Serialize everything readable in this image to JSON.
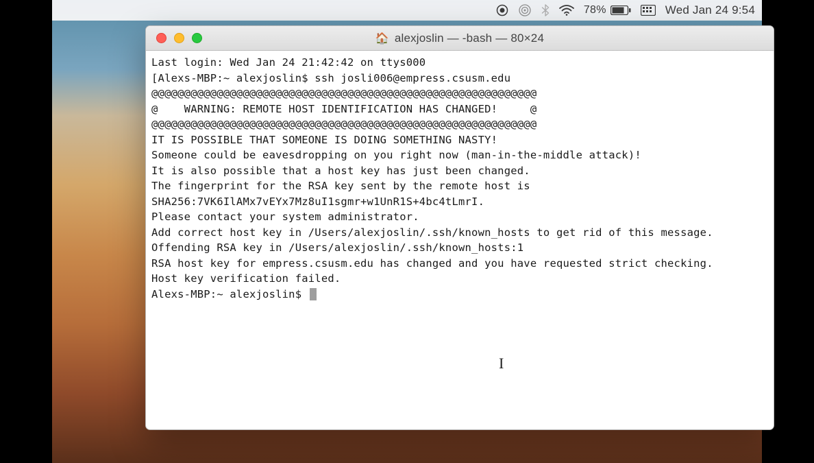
{
  "menubar": {
    "battery_pct": "78%",
    "datetime": "Wed Jan 24  9:54"
  },
  "window": {
    "title": "alexjoslin — -bash — 80×24"
  },
  "terminal": {
    "lines": [
      "Last login: Wed Jan 24 21:42:42 on ttys000",
      "[Alexs-MBP:~ alexjoslin$ ssh josli006@empress.csusm.edu",
      "@@@@@@@@@@@@@@@@@@@@@@@@@@@@@@@@@@@@@@@@@@@@@@@@@@@@@@@@@@@",
      "@    WARNING: REMOTE HOST IDENTIFICATION HAS CHANGED!     @",
      "@@@@@@@@@@@@@@@@@@@@@@@@@@@@@@@@@@@@@@@@@@@@@@@@@@@@@@@@@@@",
      "IT IS POSSIBLE THAT SOMEONE IS DOING SOMETHING NASTY!",
      "Someone could be eavesdropping on you right now (man-in-the-middle attack)!",
      "It is also possible that a host key has just been changed.",
      "The fingerprint for the RSA key sent by the remote host is",
      "SHA256:7VK6IlAMx7vEYx7Mz8uI1sgmr+w1UnR1S+4bc4tLmrI.",
      "Please contact your system administrator.",
      "Add correct host key in /Users/alexjoslin/.ssh/known_hosts to get rid of this message.",
      "Offending RSA key in /Users/alexjoslin/.ssh/known_hosts:1",
      "RSA host key for empress.csusm.edu has changed and you have requested strict checking.",
      "Host key verification failed."
    ],
    "final_prompt": "Alexs-MBP:~ alexjoslin$ "
  }
}
